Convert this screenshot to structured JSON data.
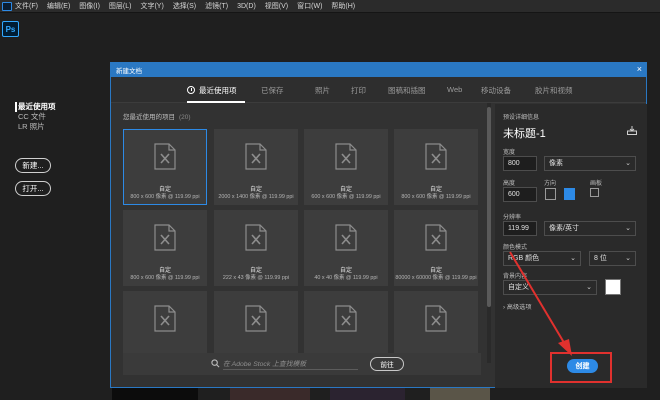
{
  "menubar": {
    "items": [
      "文件(F)",
      "编辑(E)",
      "图像(I)",
      "图层(L)",
      "文字(Y)",
      "选择(S)",
      "滤镜(T)",
      "3D(D)",
      "视图(V)",
      "窗口(W)",
      "帮助(H)"
    ]
  },
  "app": {
    "logo": "Ps"
  },
  "home": {
    "nav": [
      "最近使用项",
      "CC 文件",
      "LR 照片"
    ],
    "new_button": "新建...",
    "open_button": "打开..."
  },
  "dialog": {
    "title": "新建文档",
    "close": "×",
    "tabs": [
      "最近使用项",
      "已保存",
      "照片",
      "打印",
      "图稿和插图",
      "Web",
      "移动设备",
      "胶片和视频"
    ],
    "recent_heading": "您最近使用的项目",
    "recent_count": "(20)",
    "cards": [
      {
        "name": "自定",
        "size": "800 x 600 像素 @ 119.99 ppi"
      },
      {
        "name": "自定",
        "size": "2000 x 1400 像素 @ 119.99 ppi"
      },
      {
        "name": "自定",
        "size": "600 x 600 像素 @ 119.99 ppi"
      },
      {
        "name": "自定",
        "size": "800 x 600 像素 @ 119.99 ppi"
      },
      {
        "name": "自定",
        "size": "800 x 600 像素 @ 119.99 ppi"
      },
      {
        "name": "自定",
        "size": "222 x 43 像素 @ 119.99 ppi"
      },
      {
        "name": "自定",
        "size": "40 x 40 像素 @ 119.99 ppi"
      },
      {
        "name": "自定",
        "size": "80000 x 60000 像素 @ 119.99 ppi"
      },
      {
        "name": "",
        "size": ""
      },
      {
        "name": "",
        "size": ""
      },
      {
        "name": "",
        "size": ""
      },
      {
        "name": "",
        "size": ""
      }
    ],
    "stock_placeholder": "在 Adobe Stock 上查找模板",
    "stock_go": "前往"
  },
  "preset": {
    "section_label": "预设详细信息",
    "doc_name": "未标题-1",
    "width_label": "宽度",
    "width_value": "800",
    "width_unit": "像素",
    "height_label": "高度",
    "height_value": "600",
    "orientation_label": "方向",
    "artboard_label": "画板",
    "resolution_label": "分辨率",
    "resolution_value": "119.99",
    "resolution_unit": "像素/英寸",
    "color_mode_label": "颜色模式",
    "color_mode_value": "RGB 颜色",
    "bit_depth": "8 位",
    "bg_label": "背景内容",
    "bg_value": "自定义",
    "advanced": "高级选项",
    "chevron": "⌄"
  },
  "actions": {
    "create": "创建"
  },
  "colors": {
    "accent": "#2d8ae6",
    "annotation": "#e0312e",
    "dialog_bg": "#323232"
  }
}
